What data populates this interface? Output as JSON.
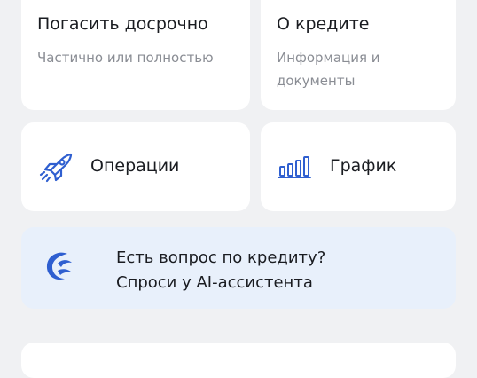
{
  "cards": {
    "early_repayment": {
      "title": "Погасить досрочно",
      "subtitle": "Частично или полностью"
    },
    "about_loan": {
      "title": "О кредите",
      "subtitle": "Информация и документы"
    },
    "operations": {
      "label": "Операции",
      "icon": "rocket-icon"
    },
    "schedule": {
      "label": "График",
      "icon": "bar-chart-icon"
    }
  },
  "ai_banner": {
    "line1": "Есть вопрос по кредиту?",
    "line2": "Спроси у AI-ассистента",
    "icon": "ai-assistant-logo-icon"
  },
  "colors": {
    "accent": "#2f5fd0",
    "background": "#f0f1f3",
    "card": "#ffffff",
    "banner": "#e8f0fb"
  }
}
